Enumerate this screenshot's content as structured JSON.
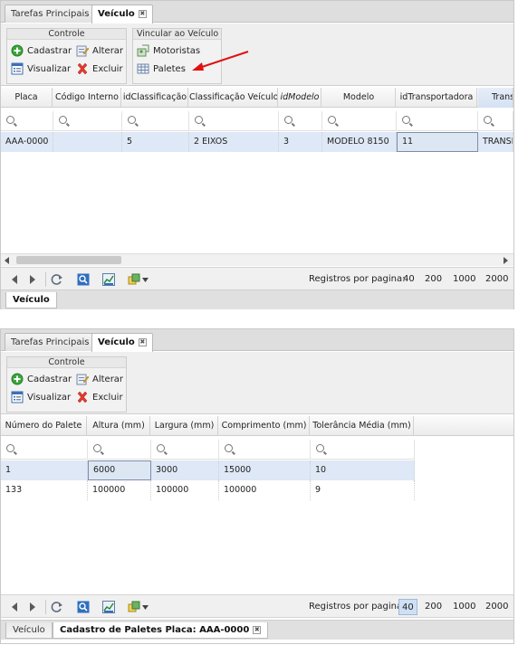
{
  "top": {
    "tabs": [
      {
        "label": "Tarefas Principais"
      },
      {
        "label": "Veículo",
        "close": "✖"
      }
    ],
    "ribbon": {
      "controle": {
        "title": "Controle",
        "cadastrar": "Cadastrar",
        "alterar": "Alterar",
        "visualizar": "Visualizar",
        "excluir": "Excluir"
      },
      "vincular": {
        "title": "Vincular ao Veículo",
        "motoristas": "Motoristas",
        "paletes": "Paletes"
      }
    },
    "grid": {
      "columns": [
        "Placa",
        "Código Interno",
        "idClassificação",
        "Classificação Veículo",
        "idModelo",
        "Modelo",
        "idTransportadora",
        "Trans"
      ],
      "rows": [
        [
          "AAA-0000",
          "",
          "5",
          "2 EIXOS",
          "3",
          "MODELO 8150",
          "11",
          "TRANSP"
        ]
      ]
    },
    "pager": {
      "label": "Registros por pagina:",
      "sizes": [
        "40",
        "200",
        "1000",
        "2000"
      ]
    },
    "bottom_tabs": [
      {
        "label": "Veículo"
      }
    ]
  },
  "bottom": {
    "tabs": [
      {
        "label": "Tarefas Principais"
      },
      {
        "label": "Veículo",
        "close": "✖"
      }
    ],
    "ribbon": {
      "controle": {
        "title": "Controle",
        "cadastrar": "Cadastrar",
        "alterar": "Alterar",
        "visualizar": "Visualizar",
        "excluir": "Excluir"
      }
    },
    "grid": {
      "columns": [
        "Número do Palete",
        "Altura (mm)",
        "Largura (mm)",
        "Comprimento (mm)",
        "Tolerância Média (mm)"
      ],
      "rows": [
        [
          "1",
          "6000",
          "3000",
          "15000",
          "10"
        ],
        [
          "133",
          "100000",
          "100000",
          "100000",
          "9"
        ]
      ]
    },
    "pager": {
      "label": "Registros por pagina:",
      "sizes": [
        "40",
        "200",
        "1000",
        "2000"
      ],
      "active_size": "40"
    },
    "bottom_tabs": [
      {
        "label": "Veículo"
      },
      {
        "label": "Cadastro de Paletes Placa: AAA-0000",
        "close": "✖"
      }
    ]
  },
  "colors": {
    "selected_row": "#dfe8f6",
    "arrow": "#e01010",
    "pager_active": "#cfe0f5"
  },
  "icons": [
    "plus-circle-icon",
    "edit-icon",
    "list-view-icon",
    "delete-x-icon",
    "driver-link-icon",
    "pallet-grid-icon",
    "first-page-icon",
    "next-page-icon",
    "refresh-icon",
    "search-icon",
    "chart-icon",
    "export-icon"
  ]
}
